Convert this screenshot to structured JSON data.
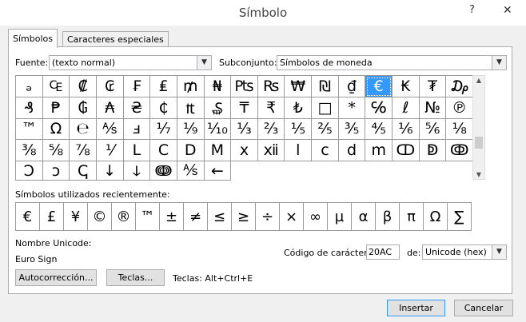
{
  "window": {
    "title": "Símbolo",
    "help": "?",
    "close": "✕"
  },
  "tabs": [
    {
      "label": "Símbolos"
    },
    {
      "label": "Caracteres especiales"
    }
  ],
  "font": {
    "label": "Fuente:",
    "value": "(texto normal)"
  },
  "subset": {
    "label": "Subconjunto:",
    "value": "Símbolos de moneda"
  },
  "symbols": [
    "ₔ",
    "₠",
    "₡",
    "₢",
    "₣",
    "₤",
    "₥",
    "₦",
    "₧",
    "₨",
    "₩",
    "₪",
    "₫",
    "€",
    "₭",
    "₮",
    "₯",
    "₰",
    "₱",
    "₲",
    "₳",
    "₴",
    "₵",
    "₶",
    "₷",
    "₸",
    "₹",
    "₺",
    "□",
    "*",
    "℅",
    "ℓ",
    "№",
    "℗",
    "™",
    "Ω",
    "℮",
    "⅍",
    "ⅎ",
    "⅐",
    "⅑",
    "⅒",
    "⅓",
    "⅔",
    "⅕",
    "⅖",
    "⅗",
    "⅘",
    "⅙",
    "⅚",
    "⅛",
    "⅜",
    "⅝",
    "⅞",
    "⅟",
    "Ⅼ",
    "Ⅽ",
    "Ⅾ",
    "Ⅿ",
    "ⅹ",
    "ⅻ",
    "ⅼ",
    "ⅽ",
    "ⅾ",
    "ⅿ",
    "ↀ",
    "ↁ",
    "ↂ",
    "Ↄ",
    "ↄ",
    "ↅ",
    "↓",
    "ↆ",
    "ↈ",
    "⅍",
    "←"
  ],
  "selected_symbol": "€",
  "recent": {
    "label": "Símbolos utilizados recientemente:",
    "items": [
      "€",
      "£",
      "¥",
      "©",
      "®",
      "™",
      "±",
      "≠",
      "≤",
      "≥",
      "÷",
      "×",
      "∞",
      "µ",
      "α",
      "β",
      "π",
      "Ω",
      "∑"
    ]
  },
  "unicode": {
    "name_label": "Nombre Unicode:",
    "name_value": "Euro Sign"
  },
  "char_code": {
    "label": "Código de carácter:",
    "value": "20AC",
    "from_label": "de:",
    "from_value": "Unicode (hex)"
  },
  "buttons": {
    "autocorrect": "Autocorrección...",
    "keys": "Teclas...",
    "shortcut": "Teclas: Alt+Ctrl+E",
    "insert": "Insertar",
    "cancel": "Cancelar"
  }
}
